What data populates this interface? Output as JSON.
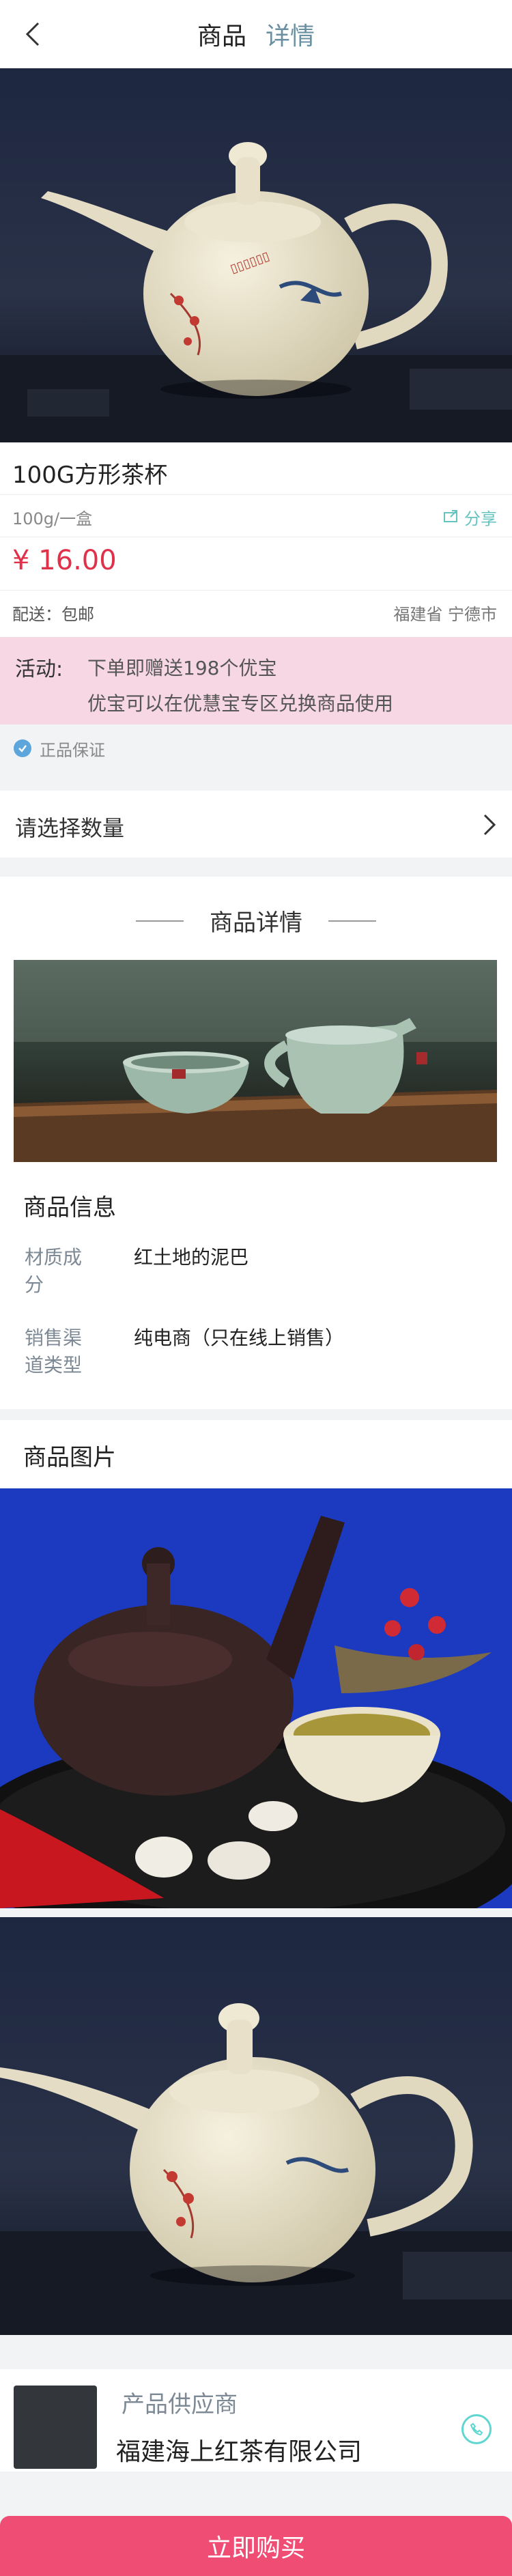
{
  "header": {
    "tab_product": "商品",
    "tab_detail": "详情"
  },
  "product": {
    "title": "100G方形茶杯",
    "spec": "100g/一盒",
    "share_label": "分享",
    "price": "¥ 16.00",
    "shipping": "配送：包邮",
    "location": "福建省 宁德市"
  },
  "activity": {
    "label": "活动:",
    "line1": "下单即赠送198个优宝",
    "line2": "优宝可以在优慧宝专区兑换商品使用"
  },
  "guarantee": {
    "text": "正品保证"
  },
  "quantity": {
    "label": "请选择数量"
  },
  "details": {
    "title": "商品详情",
    "info_heading": "商品信息",
    "rows": [
      {
        "label": "材质成分",
        "value": "红土地的泥巴"
      },
      {
        "label": "销售渠道类型",
        "value": "纯电商（只在线上销售）"
      }
    ],
    "pictures_heading": "商品图片"
  },
  "supplier": {
    "label": "产品供应商",
    "name": "福建海上红茶有限公司"
  },
  "actions": {
    "buy": "立即购买"
  },
  "colors": {
    "price": "#e0304a",
    "accent": "#66c4c0",
    "buy_button": "#ef4d74",
    "activity_bg": "#f6d7e3"
  },
  "icons": [
    "back-arrow-icon",
    "share-icon",
    "check-icon",
    "chevron-right-icon",
    "phone-icon"
  ]
}
